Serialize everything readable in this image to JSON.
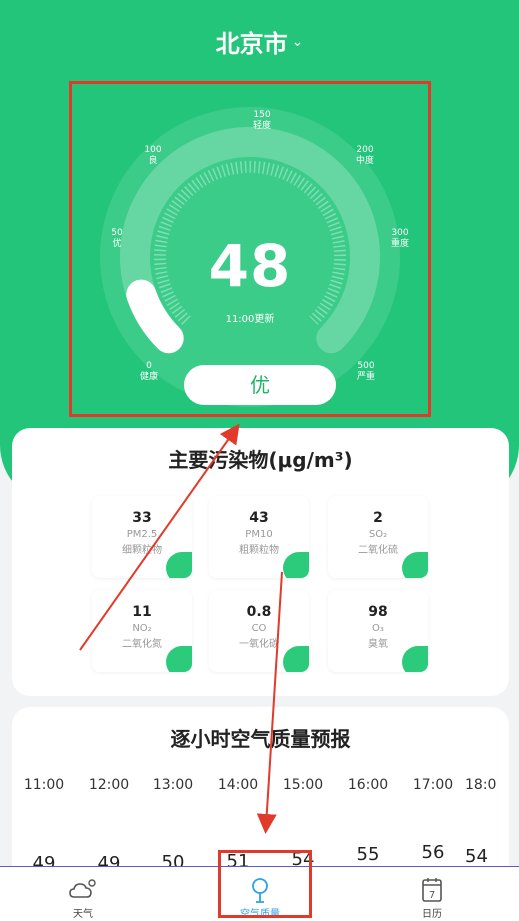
{
  "header": {
    "city": "北京市",
    "city_dropdown_icon": "chevron-down-icon"
  },
  "gauge": {
    "aqi": "48",
    "updated": "11:00更新",
    "level": "优",
    "ticks": [
      {
        "value": "0",
        "label": "健康"
      },
      {
        "value": "50",
        "label": "优"
      },
      {
        "value": "100",
        "label": "良"
      },
      {
        "value": "150",
        "label": "轻度"
      },
      {
        "value": "200",
        "label": "中度"
      },
      {
        "value": "300",
        "label": "重度"
      },
      {
        "value": "500",
        "label": "严重"
      }
    ],
    "fill_fraction": 0.096
  },
  "pollutants": {
    "title": "主要污染物(μg/m³)",
    "items": [
      {
        "value": "33",
        "code": "PM2.5",
        "name": "细颗粒物"
      },
      {
        "value": "43",
        "code": "PM10",
        "name": "粗颗粒物"
      },
      {
        "value": "2",
        "code": "SO₂",
        "name": "二氧化硫"
      },
      {
        "value": "11",
        "code": "NO₂",
        "name": "二氧化氮"
      },
      {
        "value": "0.8",
        "code": "CO",
        "name": "一氧化碳"
      },
      {
        "value": "98",
        "code": "O₃",
        "name": "臭氧"
      }
    ]
  },
  "forecast": {
    "title": "逐小时空气质量预报",
    "hours": [
      "11:00",
      "12:00",
      "13:00",
      "14:00",
      "15:00",
      "16:00",
      "17:00",
      "18:0"
    ],
    "values": [
      "49",
      "49",
      "50",
      "51",
      "54",
      "55",
      "56",
      "54"
    ]
  },
  "tabs": [
    {
      "label": "天气",
      "icon": "cloud-icon"
    },
    {
      "label": "空气质量",
      "icon": "air-quality-icon"
    },
    {
      "label": "日历",
      "icon": "calendar-icon",
      "day": "7"
    }
  ],
  "colors": {
    "brand_green": "#22c57a",
    "highlight_red": "#e23a2a",
    "active_tab": "#2ea2e8"
  }
}
